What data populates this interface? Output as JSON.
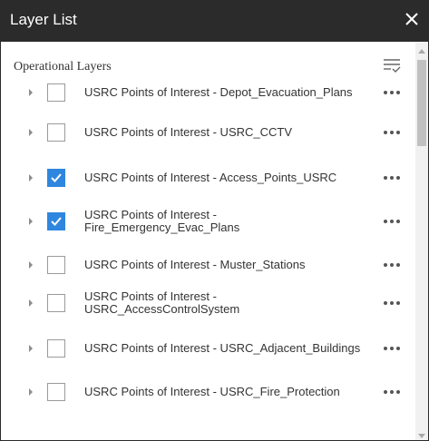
{
  "panel": {
    "title": "Layer List",
    "close_icon": "close-icon"
  },
  "section": {
    "heading": "Operational Layers",
    "options_icon": "list-options-icon"
  },
  "layers": [
    {
      "label": "USRC Points of Interest - Depot_Evacuation_Plans",
      "checked": false
    },
    {
      "label": "USRC Points of Interest - USRC_CCTV",
      "checked": false
    },
    {
      "label": "USRC Points of Interest - Access_Points_USRC",
      "checked": true
    },
    {
      "label": "USRC Points of Interest - Fire_Emergency_Evac_Plans",
      "checked": true
    },
    {
      "label": "USRC Points of Interest - Muster_Stations",
      "checked": false
    },
    {
      "label": "USRC Points of Interest - USRC_AccessControlSystem",
      "checked": false
    },
    {
      "label": "USRC Points of Interest - USRC_Adjacent_Buildings",
      "checked": false
    },
    {
      "label": "USRC Points of Interest - USRC_Fire_Protection",
      "checked": false
    }
  ],
  "colors": {
    "titlebar": "#2b2b2b",
    "checkbox_checked": "#2e86de"
  }
}
